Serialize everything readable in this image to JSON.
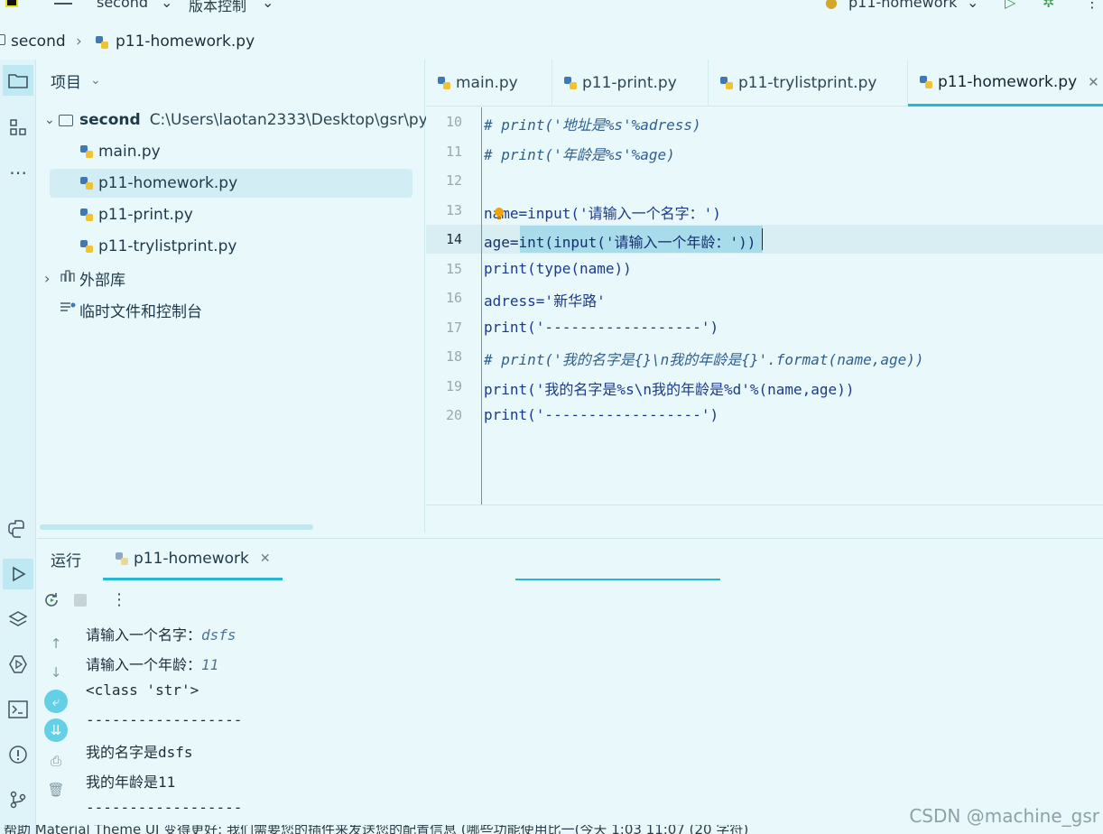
{
  "topbar": {
    "project_name": "second",
    "vcs_label": "版本控制",
    "run_config": "p11-homework"
  },
  "breadcrumb": {
    "project": "second",
    "file": "p11-homework.py"
  },
  "project_panel": {
    "title": "项目",
    "root_name": "second",
    "root_path": "C:\\Users\\laotan2333\\Desktop\\gsr\\py",
    "files": [
      "main.py",
      "p11-homework.py",
      "p11-print.py",
      "p11-trylistprint.py"
    ],
    "external_libs": "外部库",
    "scratches": "临时文件和控制台"
  },
  "tabs": [
    "main.py",
    "p11-print.py",
    "p11-trylistprint.py",
    "p11-homework.py"
  ],
  "editor": {
    "line_numbers": [
      "10",
      "11",
      "12",
      "13",
      "14",
      "15",
      "16",
      "17",
      "18",
      "19",
      "20"
    ],
    "lines": [
      "# print('地址是%s'%adress)",
      "# print('年龄是%s'%age)",
      "",
      "name=input('请输入一个名字：')",
      "age=int(input('请输入一个年龄：'))",
      "print(type(name))",
      "adress='新华路'",
      "print('------------------')",
      "# print('我的名字是{}\\n我的年龄是{}'.format(name,age))",
      "print('我的名字是%s\\n我的年龄是%d'%(name,age))",
      "print('------------------')"
    ]
  },
  "run_panel": {
    "title": "运行",
    "tab": "p11-homework",
    "output": [
      {
        "prompt": "请输入一个名字：",
        "input": "dsfs"
      },
      {
        "prompt": "请输入一个年龄：",
        "input": "11"
      },
      {
        "prompt": "<class 'str'>",
        "input": ""
      },
      {
        "prompt": "------------------",
        "input": ""
      },
      {
        "prompt": "我的名字是dsfs",
        "input": ""
      },
      {
        "prompt": "我的年龄是11",
        "input": ""
      },
      {
        "prompt": "------------------",
        "input": ""
      }
    ]
  },
  "watermark": "CSDN @machine_gsr",
  "statusbar_text": "帮助 Material Theme UI 变得更好: 我们需要您的插件来发送您的配置信息 (哪些功能使用比一(今天 1:03    11:07 (20 字符)"
}
